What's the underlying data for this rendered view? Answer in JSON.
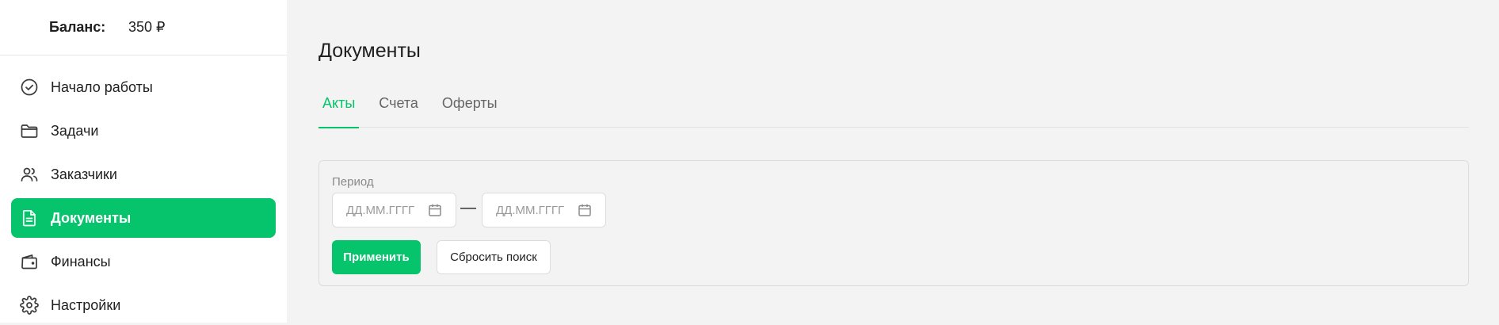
{
  "sidebar": {
    "balance_label": "Баланс:",
    "balance_value": "350 ₽",
    "items": [
      {
        "label": "Начало работы",
        "icon": "check-circle-icon"
      },
      {
        "label": "Задачи",
        "icon": "folder-icon"
      },
      {
        "label": "Заказчики",
        "icon": "users-icon"
      },
      {
        "label": "Документы",
        "icon": "document-icon",
        "active": true
      },
      {
        "label": "Финансы",
        "icon": "wallet-icon"
      },
      {
        "label": "Настройки",
        "icon": "gear-icon"
      }
    ]
  },
  "main": {
    "title": "Документы",
    "tabs": [
      {
        "label": "Акты",
        "active": true
      },
      {
        "label": "Счета"
      },
      {
        "label": "Оферты"
      }
    ],
    "filter": {
      "period_label": "Период",
      "date_from_placeholder": "ДД.ММ.ГГГГ",
      "date_to_placeholder": "ДД.ММ.ГГГГ",
      "separator": "—",
      "apply_label": "Применить",
      "reset_label": "Сбросить поиск"
    }
  },
  "colors": {
    "accent": "#05c46b",
    "background": "#f3f3f3",
    "sidebar": "#ffffff"
  }
}
